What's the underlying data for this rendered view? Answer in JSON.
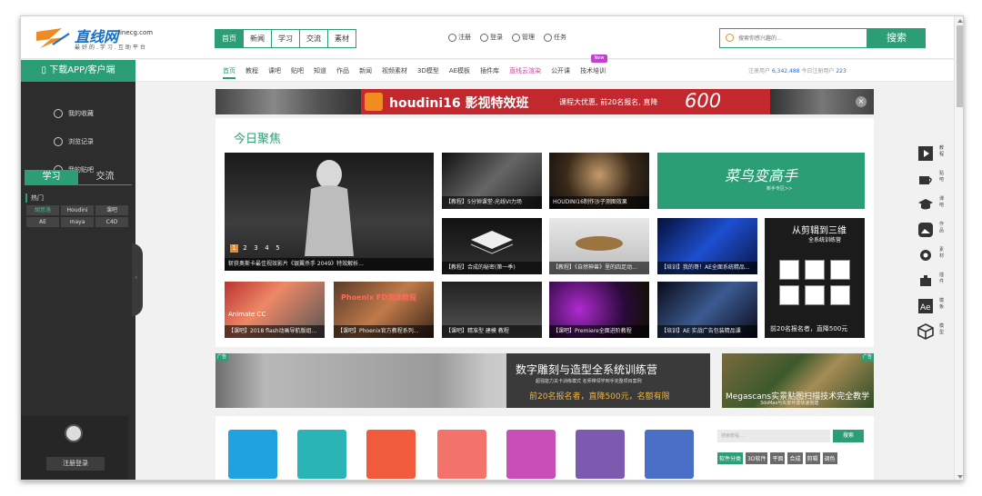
{
  "logo": {
    "name": "直线网",
    "domain": "linecg.com",
    "slogan": "最好的.学习.互助平台"
  },
  "topnav": [
    "首页",
    "新闻",
    "学习",
    "交流",
    "素材"
  ],
  "toplinks": [
    "注册",
    "登录",
    "管理",
    "任务"
  ],
  "search": {
    "placeholder": "搜索你感兴趣的...",
    "button": "搜索"
  },
  "subnav": {
    "items": [
      "首页",
      "教程",
      "课吧",
      "贴吧",
      "知道",
      "作品",
      "新闻",
      "视频素材",
      "3D模型",
      "AE模板",
      "插件库",
      "直线云渲染",
      "公开课",
      "技术培训"
    ],
    "badge": "New",
    "stats_prefix": "注册用户",
    "registered": "6,342,488",
    "today_prefix": "今日注册用户",
    "today": "223"
  },
  "sidebar": {
    "download": "下载APP/客户端",
    "links": [
      "我的收藏",
      "浏览记录",
      "我的贴吧"
    ],
    "tabs": [
      "学习",
      "交流"
    ],
    "hot_label": "热门",
    "tags": [
      "胡思洛",
      "Houdini",
      "课吧",
      "AE",
      "maya",
      "C4D"
    ],
    "login": "注册登录"
  },
  "banner": {
    "title": "houdini16 影视特效班",
    "promo": "课程大优惠, 前20名报名, 直降",
    "amount": "600",
    "close": "×"
  },
  "focus": {
    "title": "今日聚焦",
    "dots": [
      "1",
      "2",
      "3",
      "4",
      "5"
    ],
    "tiles": [
      "斩获奥斯卡最佳视效影片《银翼杀手 2049》特效解析...",
      "【教程】5分钟课堂-光线VI力场",
      "HOUDINI16制作沙子测图效果",
      "【教程】合成的秘密(第一季)",
      "【教程】《自然神兽》里的四足动...",
      "【培训】我的哥！AE全面系统精品...",
      "【课吧】2018 flash动画导航版组...",
      "【课吧】Phoenix官方教程系列...",
      "【课吧】精准型 建模 教程",
      "【课吧】Premiere全面进阶教程",
      "【培训】AE 实战广告包装精品课"
    ],
    "tile_overlays": [
      "Animate CC",
      "Phoenix FD流体教程"
    ],
    "promo_green": {
      "title": "菜鸟变高手",
      "sub": "新手专区>>"
    },
    "promo_bw": {
      "title": "从剪辑到三维",
      "sub": "全系统训练营",
      "bottom": "前20名报名者，直降500元"
    }
  },
  "ads": {
    "tag": "广告",
    "left": {
      "title": "数字雕刻与造型全系统训练营",
      "sub": "超强能力关卡训练模式 名师带领学到手完整项目案例",
      "price": "前20名报名者，直降500元，名额有限"
    },
    "right": {
      "title": "Megascans实景贴图扫描技术完全教学",
      "sub": "3dsMax与实景环境快速搭建"
    }
  },
  "categories": {
    "search_placeholder": "搜索教程...",
    "search_button": "搜索",
    "tabs": [
      "软件分类",
      "3D软件",
      "平面",
      "合成",
      "剪辑",
      "调色"
    ],
    "colors": [
      "#1ea3e0",
      "#2bb4b5",
      "#f15b3d",
      "#f3726a",
      "#c74fb6",
      "#7c5ab0",
      "#4a6fc7"
    ]
  },
  "rightbar": [
    "教程",
    "贴吧",
    "课吧",
    "作品",
    "素材",
    "插件",
    "模板",
    "模型"
  ]
}
